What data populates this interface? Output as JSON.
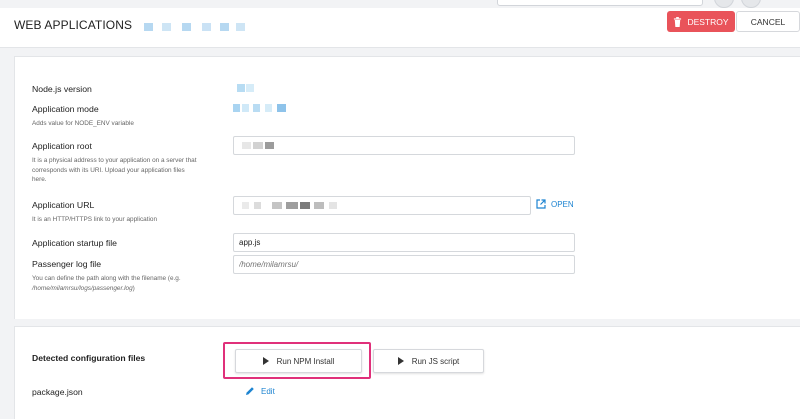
{
  "header": {
    "title": "WEB APPLICATIONS",
    "destroy_label": "DESTROY",
    "cancel_label": "CANCEL"
  },
  "form": {
    "nodejs_version": {
      "label": "Node.js version"
    },
    "app_mode": {
      "label": "Application mode",
      "hint": "Adds value for NODE_ENV variable"
    },
    "app_root": {
      "label": "Application root",
      "hint": "It is a physical address to your application on a server that corresponds with its URI. Upload your application files here."
    },
    "app_url": {
      "label": "Application URL",
      "hint": "It is an HTTP/HTTPS link to your application",
      "open_label": "OPEN"
    },
    "startup_file": {
      "label": "Application startup file",
      "value": "app.js"
    },
    "passenger_log": {
      "label": "Passenger log file",
      "placeholder": "/home/milamrsu/",
      "hint_prefix": "You can define the path along with the filename (e.g. ",
      "hint_example": "/home/milamrsu/logs/passenger.log",
      "hint_suffix": ")"
    }
  },
  "config": {
    "section_label": "Detected configuration files",
    "run_npm_label": "Run NPM Install",
    "run_js_label": "Run JS script",
    "file_name": "package.json",
    "edit_label": "Edit"
  },
  "colors": {
    "destroy": "#e9535a",
    "link": "#1d84d1",
    "highlight": "#e0307a"
  },
  "icons": {
    "destroy": "trash-icon",
    "open": "external-link-icon",
    "run": "play-icon",
    "edit": "pencil-icon"
  }
}
